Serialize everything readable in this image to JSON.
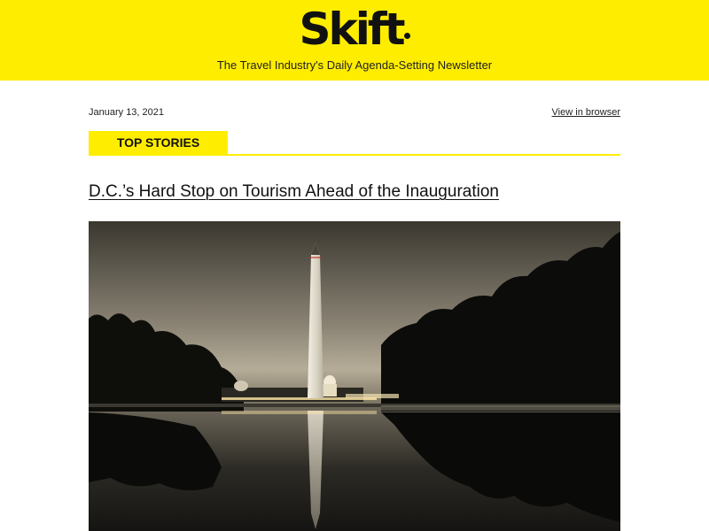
{
  "header": {
    "logo_text": "Skift",
    "tagline": "The Travel Industry's Daily Agenda-Setting Newsletter",
    "brand_color": "#ffed00"
  },
  "meta": {
    "date": "January 13, 2021",
    "view_in_browser": "View in browser"
  },
  "section": {
    "label": "TOP STORIES"
  },
  "story": {
    "headline": "D.C.’s Hard Stop on Tourism Ahead of the Inauguration",
    "image_subject": "washington-monument-reflecting-pool-night"
  }
}
